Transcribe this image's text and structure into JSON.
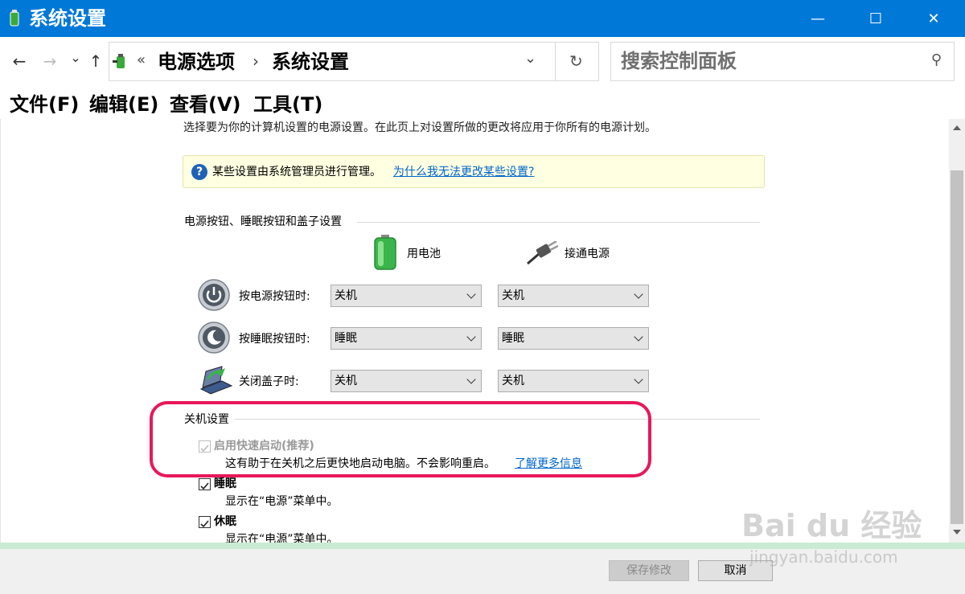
{
  "window": {
    "title": "系统设置",
    "minimize_glyph": "—",
    "maximize_glyph": "☐",
    "close_glyph": "✕"
  },
  "nav": {
    "back_glyph": "←",
    "forward_glyph": "→",
    "recent_glyph": "⌄",
    "up_glyph": "↑",
    "breadcrumb_prefix": "«",
    "breadcrumb": [
      "电源选项",
      "系统设置"
    ],
    "breadcrumb_sep": "›",
    "dropdown_glyph": "⌄",
    "refresh_glyph": "↻",
    "search_placeholder": "搜索控制面板",
    "search_icon_glyph": "⚲"
  },
  "menu": [
    "文件(F)",
    "编辑(E)",
    "查看(V)",
    "工具(T)"
  ],
  "content": {
    "intro": "选择要为你的计算机设置的电源设置。在此页上对设置所做的更改将应用于你所有的电源计划。",
    "info_text": "某些设置由系统管理员进行管理。",
    "info_link": "为什么我无法更改某些设置?",
    "section1_title": "电源按钮、睡眠按钮和盖子设置",
    "col_battery": "用电池",
    "col_plugged": "接通电源",
    "rows": [
      {
        "label": "按电源按钮时:",
        "battery": "关机",
        "plugged": "关机"
      },
      {
        "label": "按睡眠按钮时:",
        "battery": "睡眠",
        "plugged": "睡眠"
      },
      {
        "label": "关闭盖子时:",
        "battery": "关机",
        "plugged": "关机"
      }
    ],
    "section2_title": "关机设置",
    "fast_startup": {
      "label": "启用快速启动(推荐)",
      "desc": "这有助于在关机之后更快地启动电脑。不会影响重启。",
      "link": "了解更多信息"
    },
    "sleep": {
      "label": "睡眠",
      "desc": "显示在“电源”菜单中。"
    },
    "hibernate": {
      "label": "休眠",
      "desc": "显示在“电源”菜单中。"
    }
  },
  "buttons": {
    "save": "保存修改",
    "cancel": "取消"
  },
  "watermark": {
    "brand": "Bai du 经验",
    "url": "jingyan.baidu.com"
  },
  "colors": {
    "titlebar": "#0078d7",
    "highlight_border": "#e8185a",
    "info_bg": "#ffffe1",
    "link": "#0066cc",
    "footer_accent": "#c9ebd4"
  }
}
